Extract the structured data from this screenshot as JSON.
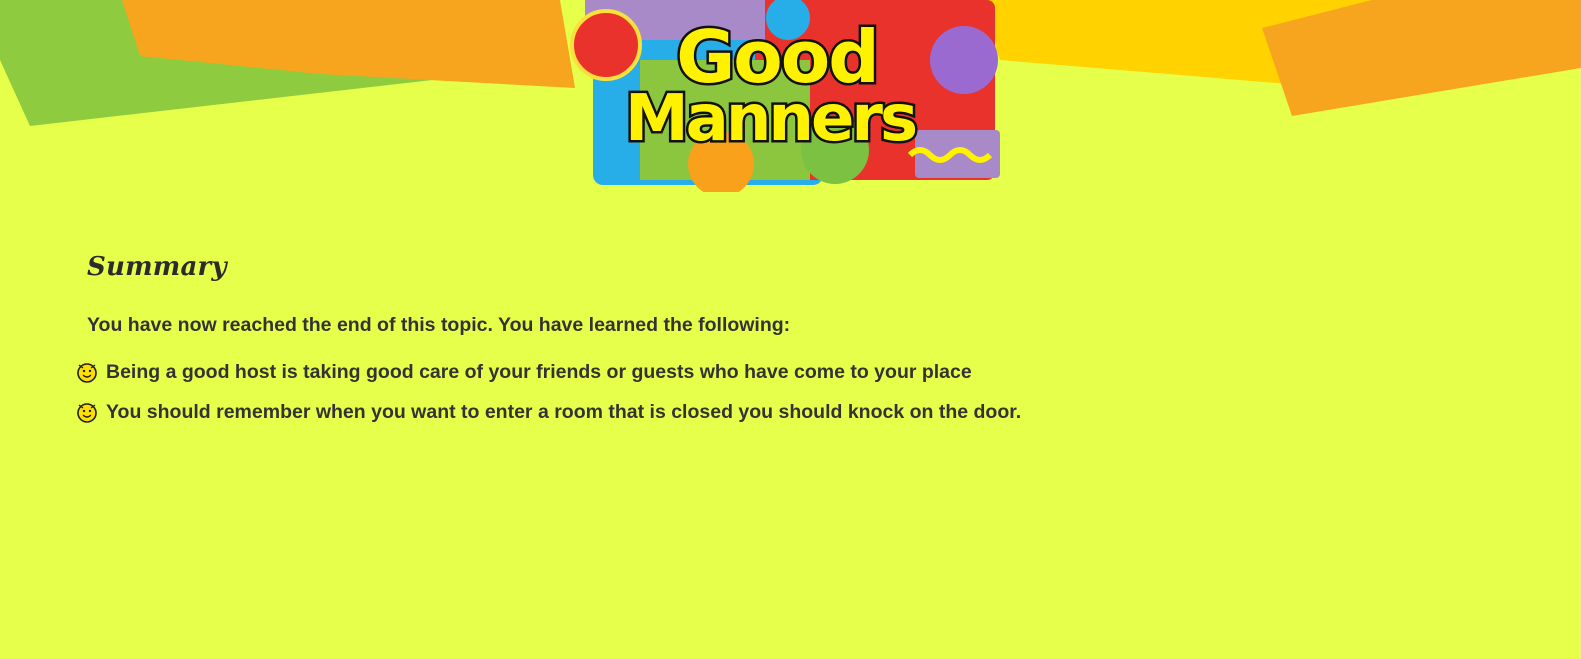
{
  "logo": {
    "line1": "Good",
    "line2": "Manners"
  },
  "summary": {
    "title": "Summary",
    "intro": "You have now reached the end of this topic. You have learned the following:",
    "bullet_icon": "smiley-bullet-icon",
    "items": [
      "Being a good host is taking good care of your friends or guests who have come to your place",
      "You should remember when you want to enter a room that is closed you should knock on the door."
    ]
  },
  "colors": {
    "background": "#e6ff4a",
    "green_shape": "#8fcb3e",
    "orange_shape": "#f7a51e",
    "yellow_shape": "#ffd200",
    "text": "#333333",
    "logo_text": "#fff200"
  }
}
